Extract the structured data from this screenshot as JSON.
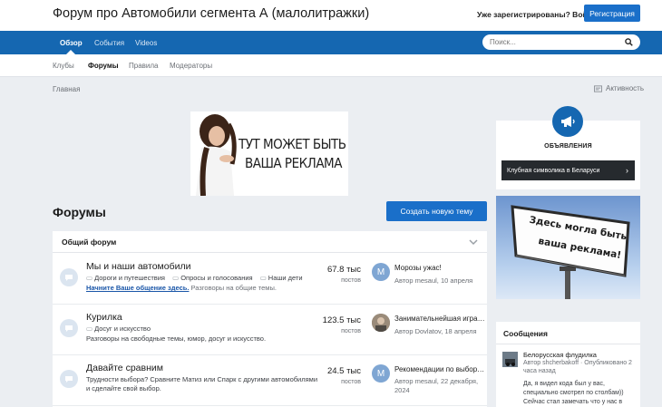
{
  "header": {
    "site_title": "Форум про Автомобили сегмента А (малолитражки)",
    "login_link": "Уже зарегистрированы? Войти",
    "register_button": "Регистрация"
  },
  "nav": {
    "tabs": [
      {
        "label": "Обзор",
        "active": true
      },
      {
        "label": "События",
        "active": false
      },
      {
        "label": "Videos",
        "active": false
      }
    ],
    "search_placeholder": "Поиск..."
  },
  "subnav": {
    "items": [
      {
        "label": "Клубы",
        "active": false
      },
      {
        "label": "Форумы",
        "active": true
      },
      {
        "label": "Правила",
        "active": false
      },
      {
        "label": "Модераторы",
        "active": false
      }
    ]
  },
  "breadcrumb": "Главная",
  "activity_link": "Активность",
  "ad_banner": {
    "line1": "ТУТ МОЖЕТ БЫТЬ",
    "line2": "ВАША РЕКЛАМА"
  },
  "forums": {
    "title": "Форумы",
    "new_topic_button": "Создать новую тему",
    "category": "Общий форум",
    "rows": [
      {
        "title": "Мы и наши автомобили",
        "subforums": [
          "Дороги и путешествия",
          "Опросы и голосования",
          "Наши дети"
        ],
        "link": "Начните Ваше общение здесь.",
        "description": "Разговоры на общие темы.",
        "count": "67.8 тыс",
        "count_label": "постов",
        "avatar_letter": "M",
        "last_title": "Морозы ужас!",
        "last_meta_1": "Автор mesaul, 10 апреля",
        "last_meta_2": ""
      },
      {
        "title": "Курилка",
        "subforums": [
          "Досуг и искусство"
        ],
        "link": "",
        "description": "Разговоры на свободные темы, юмор, досуг и искусство.",
        "count": "123.5 тыс",
        "count_label": "постов",
        "avatar_letter": "",
        "last_title": "Занимательнейшая игра: ...",
        "last_meta_1": "Автор Dovlatov, 18 апреля",
        "last_meta_2": ""
      },
      {
        "title": "Давайте сравним",
        "subforums": [],
        "link": "",
        "description": "Трудности выбора? Сравните Матиз или Спарк с другими автомобилями",
        "description_2": "и сделайте свой выбор.",
        "count": "24.5 тыс",
        "count_label": "постов",
        "avatar_letter": "M",
        "last_title": "Рекомендации по выбору ...",
        "last_meta_1": "Автор mesaul, 22 декабря,",
        "last_meta_2": "2024"
      }
    ]
  },
  "sidebar": {
    "announcements_title": "ОБЪЯВЛЕНИЯ",
    "announcement_item": "Клубная символика в Беларуси",
    "billboard_text_1": "Здесь могла быть",
    "billboard_text_2": "ваша реклама!",
    "messages_title": "Сообщения",
    "message": {
      "topic": "Белорусская флудилка",
      "meta_1": "Автор shcherbakoff · Опубликовано 2",
      "meta_2": "часа назад",
      "snippet_1": "Да, я видел кода был у вас,",
      "snippet_2": "специально смотрел по столбам))",
      "snippet_3": "Сейчас стал замечать что у нас в"
    }
  },
  "colors": {
    "brand_blue": "#1567b1",
    "button_blue": "#1a6fc9",
    "page_bg": "#ebeef2"
  }
}
